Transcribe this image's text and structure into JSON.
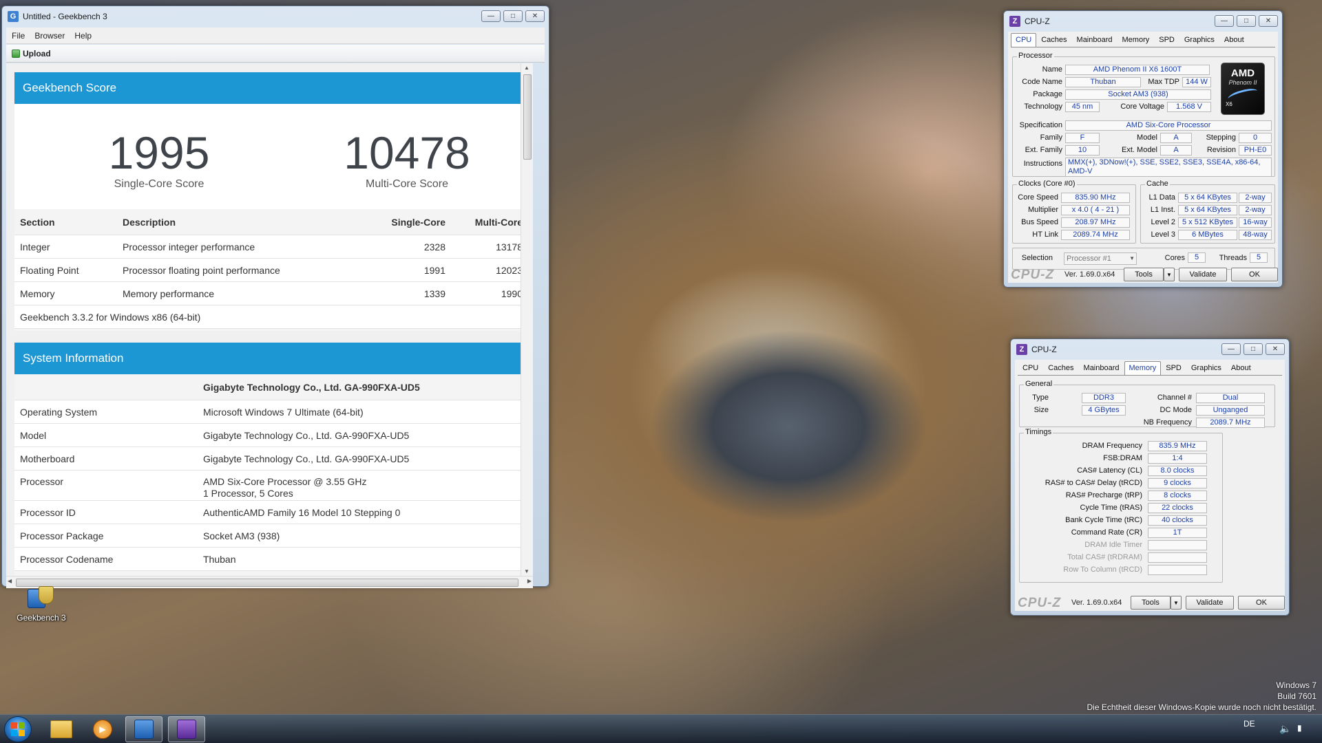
{
  "geekbench": {
    "title": "Untitled - Geekbench 3",
    "menu": [
      "File",
      "Browser",
      "Help"
    ],
    "upload": "Upload",
    "score_header": "Geekbench Score",
    "single_score": "1995",
    "single_label": "Single-Core Score",
    "multi_score": "10478",
    "multi_label": "Multi-Core Score",
    "table_head": [
      "Section",
      "Description",
      "Single-Core",
      "Multi-Core"
    ],
    "rows": [
      [
        "Integer",
        "Processor integer performance",
        "2328",
        "13178"
      ],
      [
        "Floating Point",
        "Processor floating point performance",
        "1991",
        "12023"
      ],
      [
        "Memory",
        "Memory performance",
        "1339",
        "1990"
      ]
    ],
    "version_note": "Geekbench 3.3.2 for Windows x86 (64-bit)",
    "sysinfo_header": "System Information",
    "sysinfo_title": "Gigabyte Technology Co., Ltd. GA-990FXA-UD5",
    "sysinfo": [
      [
        "Operating System",
        "Microsoft Windows 7 Ultimate (64-bit)",
        ""
      ],
      [
        "Model",
        "Gigabyte Technology Co., Ltd. GA-990FXA-UD5",
        ""
      ],
      [
        "Motherboard",
        "Gigabyte Technology Co., Ltd. GA-990FXA-UD5",
        ""
      ],
      [
        "Processor",
        "AMD Six-Core Processor @ 3.55 GHz",
        "1 Processor, 5 Cores"
      ],
      [
        "Processor ID",
        "AuthenticAMD Family 16 Model 10 Stepping 0",
        ""
      ],
      [
        "Processor Package",
        "Socket AM3 (938)",
        ""
      ],
      [
        "Processor Codename",
        "Thuban",
        ""
      ]
    ]
  },
  "cpuz1": {
    "title": "CPU-Z",
    "tabs": [
      "CPU",
      "Caches",
      "Mainboard",
      "Memory",
      "SPD",
      "Graphics",
      "About"
    ],
    "processor_group": "Processor",
    "name_l": "Name",
    "name": "AMD Phenom II X6 1600T",
    "code_l": "Code Name",
    "code": "Thuban",
    "tdp_l": "Max TDP",
    "tdp": "144 W",
    "package_l": "Package",
    "package": "Socket AM3 (938)",
    "tech_l": "Technology",
    "tech": "45 nm",
    "volt_l": "Core Voltage",
    "volt": "1.568 V",
    "spec_l": "Specification",
    "spec": "AMD Six-Core Processor",
    "family_l": "Family",
    "family": "F",
    "model_l": "Model",
    "model": "A",
    "step_l": "Stepping",
    "step": "0",
    "extfam_l": "Ext. Family",
    "extfam": "10",
    "extmod_l": "Ext. Model",
    "extmod": "A",
    "rev_l": "Revision",
    "rev": "PH-E0",
    "instr_l": "Instructions",
    "instr": "MMX(+), 3DNow!(+), SSE, SSE2, SSE3, SSE4A, x86-64, AMD-V",
    "clocks_group": "Clocks (Core #0)",
    "cspeed_l": "Core Speed",
    "cspeed": "835.90 MHz",
    "mult_l": "Multiplier",
    "mult": "x 4.0 ( 4 - 21 )",
    "bus_l": "Bus Speed",
    "bus": "208.97 MHz",
    "ht_l": "HT Link",
    "ht": "2089.74 MHz",
    "cache_group": "Cache",
    "l1d_l": "L1 Data",
    "l1d": "5 x 64 KBytes",
    "l1d_w": "2-way",
    "l1i_l": "L1 Inst.",
    "l1i": "5 x 64 KBytes",
    "l1i_w": "2-way",
    "l2_l": "Level 2",
    "l2": "5 x 512 KBytes",
    "l2_w": "16-way",
    "l3_l": "Level 3",
    "l3": "6 MBytes",
    "l3_w": "48-way",
    "sel_l": "Selection",
    "sel": "Processor #1",
    "cores_l": "Cores",
    "cores": "5",
    "threads_l": "Threads",
    "threads": "5",
    "logo_text": "CPU-Z",
    "ver": "Ver. 1.69.0.x64",
    "tools": "Tools",
    "validate": "Validate",
    "ok": "OK",
    "amd_logo": {
      "brand": "AMD",
      "line": "Phenom II",
      "model": "X6"
    }
  },
  "cpuz2": {
    "title": "CPU-Z",
    "tabs": [
      "CPU",
      "Caches",
      "Mainboard",
      "Memory",
      "SPD",
      "Graphics",
      "About"
    ],
    "general_group": "General",
    "type_l": "Type",
    "type": "DDR3",
    "size_l": "Size",
    "size": "4 GBytes",
    "chan_l": "Channel #",
    "chan": "Dual",
    "dc_l": "DC Mode",
    "dc": "Unganged",
    "nb_l": "NB Frequency",
    "nb": "2089.7 MHz",
    "timings_group": "Timings",
    "timings": [
      [
        "DRAM Frequency",
        "835.9 MHz",
        true
      ],
      [
        "FSB:DRAM",
        "1:4",
        true
      ],
      [
        "CAS# Latency (CL)",
        "8.0 clocks",
        true
      ],
      [
        "RAS# to CAS# Delay (tRCD)",
        "9 clocks",
        true
      ],
      [
        "RAS# Precharge (tRP)",
        "8 clocks",
        true
      ],
      [
        "Cycle Time (tRAS)",
        "22 clocks",
        true
      ],
      [
        "Bank Cycle Time (tRC)",
        "40 clocks",
        true
      ],
      [
        "Command Rate (CR)",
        "1T",
        true
      ],
      [
        "DRAM Idle Timer",
        "",
        false
      ],
      [
        "Total CAS# (tRDRAM)",
        "",
        false
      ],
      [
        "Row To Column (tRCD)",
        "",
        false
      ]
    ],
    "logo_text": "CPU-Z",
    "ver": "Ver. 1.69.0.x64",
    "tools": "Tools",
    "validate": "Validate",
    "ok": "OK"
  },
  "desktop": {
    "icon_label": "Geekbench 3",
    "watermark_1": "Windows 7",
    "watermark_2": "Build 7601",
    "watermark_3": "Die Echtheit dieser Windows-Kopie wurde noch nicht bestätigt.",
    "lang": "DE"
  },
  "colors": {
    "geekbench_blue": "#1d97d4",
    "cpuz_value_blue": "#1a3ea8"
  }
}
